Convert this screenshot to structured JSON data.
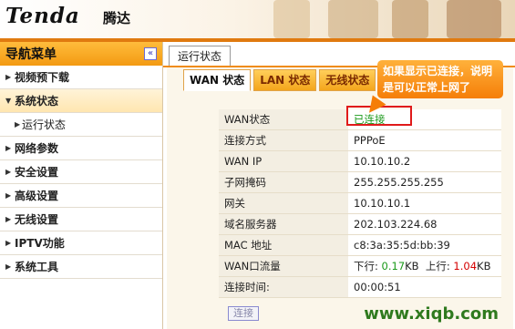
{
  "header": {
    "logo_text": "Tenda",
    "logo_cn": "腾达"
  },
  "sidebar": {
    "title": "导航菜单",
    "collapse_glyph": "«",
    "items": [
      {
        "label": "视频预下载",
        "state": "collapsed"
      },
      {
        "label": "系统状态",
        "state": "open"
      },
      {
        "label": "运行状态",
        "state": "sub"
      },
      {
        "label": "网络参数",
        "state": "collapsed"
      },
      {
        "label": "安全设置",
        "state": "collapsed"
      },
      {
        "label": "高级设置",
        "state": "collapsed"
      },
      {
        "label": "无线设置",
        "state": "collapsed"
      },
      {
        "label": "IPTV功能",
        "state": "collapsed"
      },
      {
        "label": "系统工具",
        "state": "collapsed"
      }
    ]
  },
  "main": {
    "top_tab": "运行状态",
    "sub_tabs": [
      "WAN 状态",
      "LAN 状态",
      "无线状态"
    ],
    "rows": [
      {
        "label": "WAN状态",
        "value": "已连接"
      },
      {
        "label": "连接方式",
        "value": "PPPoE"
      },
      {
        "label": "WAN IP",
        "value": "10.10.10.2"
      },
      {
        "label": "子网掩码",
        "value": "255.255.255.255"
      },
      {
        "label": "网关",
        "value": "10.10.10.1"
      },
      {
        "label": "域名服务器",
        "value": "202.103.224.68"
      },
      {
        "label": "MAC 地址",
        "value": "c8:3a:35:5d:bb:39"
      },
      {
        "label": "WAN口流量",
        "down_label": "下行:",
        "down_value": "0.17",
        "down_unit": "KB",
        "up_label": "上行:",
        "up_value": "1.04",
        "up_unit": "KB"
      },
      {
        "label": "连接时间:",
        "value": "00:00:51"
      }
    ],
    "connect_button": "连接"
  },
  "callout": {
    "text": "如果显示已连接，说明是可以正常上网了"
  },
  "watermark": "www.xiqb.com",
  "colors": {
    "accent": "#f39a12",
    "connected": "#1b9a1b",
    "highlight": "#e01a1a"
  }
}
